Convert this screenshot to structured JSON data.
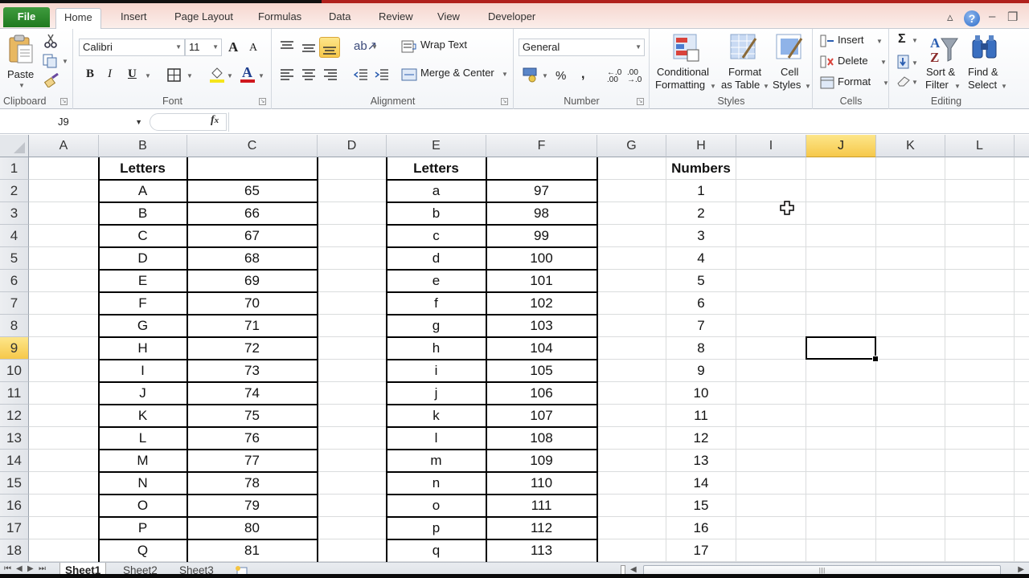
{
  "window": {
    "controls": {
      "minimize_ribbon": "▵",
      "help": "?",
      "minimize": "–",
      "restore": "❐"
    }
  },
  "tabs": [
    {
      "label": "File"
    },
    {
      "label": "Home",
      "active": true
    },
    {
      "label": "Insert"
    },
    {
      "label": "Page Layout"
    },
    {
      "label": "Formulas"
    },
    {
      "label": "Data"
    },
    {
      "label": "Review"
    },
    {
      "label": "View"
    },
    {
      "label": "Developer"
    }
  ],
  "ribbon": {
    "clipboard": {
      "label": "Clipboard",
      "paste": "Paste"
    },
    "font": {
      "label": "Font",
      "name": "Calibri",
      "size": "11",
      "bold": "B",
      "italic": "I",
      "underline": "U",
      "grow": "A",
      "shrink": "A",
      "fill_color": "#f5e51c",
      "font_color": "#d0181e"
    },
    "alignment": {
      "label": "Alignment",
      "wrap_text": "Wrap Text",
      "merge_center": "Merge & Center"
    },
    "number": {
      "label": "Number",
      "format": "General",
      "percent": "%",
      "comma": ",",
      "inc_decimal": "←.0 .00",
      "dec_decimal": ".00 →.0"
    },
    "styles": {
      "label": "Styles",
      "conditional": [
        "Conditional",
        "Formatting"
      ],
      "format_table": [
        "Format",
        "as Table"
      ],
      "cell_styles": [
        "Cell",
        "Styles"
      ]
    },
    "cells": {
      "label": "Cells",
      "insert": "Insert",
      "delete": "Delete",
      "format": "Format"
    },
    "editing": {
      "label": "Editing",
      "sort_filter": [
        "Sort &",
        "Filter"
      ],
      "find_select": [
        "Find &",
        "Select"
      ],
      "sum": "Σ"
    }
  },
  "formula_bar": {
    "name_box": "J9",
    "fx": "fx",
    "value": ""
  },
  "sheet": {
    "columns": [
      "A",
      "B",
      "C",
      "D",
      "E",
      "F",
      "G",
      "H",
      "I",
      "J",
      "K",
      "L"
    ],
    "selected_column": "J",
    "selected_row": 9,
    "selected_cell": "J9",
    "rows": [
      1,
      2,
      3,
      4,
      5,
      6,
      7,
      8,
      9,
      10,
      11,
      12,
      13,
      14,
      15,
      16,
      17,
      18
    ],
    "headers": {
      "B1": "Letters",
      "E1": "Letters",
      "H1": "Numbers"
    },
    "uppercase_letters": [
      "A",
      "B",
      "C",
      "D",
      "E",
      "F",
      "G",
      "H",
      "I",
      "J",
      "K",
      "L",
      "M",
      "N",
      "O",
      "P",
      "Q"
    ],
    "uppercase_codes": [
      "65",
      "66",
      "67",
      "68",
      "69",
      "70",
      "71",
      "72",
      "73",
      "74",
      "75",
      "76",
      "77",
      "78",
      "79",
      "80",
      "81"
    ],
    "lowercase_letters": [
      "a",
      "b",
      "c",
      "d",
      "e",
      "f",
      "g",
      "h",
      "i",
      "j",
      "k",
      "l",
      "m",
      "n",
      "o",
      "p",
      "q"
    ],
    "lowercase_codes": [
      "97",
      "98",
      "99",
      "100",
      "101",
      "102",
      "103",
      "104",
      "105",
      "106",
      "107",
      "108",
      "109",
      "110",
      "111",
      "112",
      "113"
    ],
    "numbers": [
      "1",
      "2",
      "3",
      "4",
      "5",
      "6",
      "7",
      "8",
      "9",
      "10",
      "11",
      "12",
      "13",
      "14",
      "15",
      "16",
      "17"
    ]
  },
  "sheet_tabs": [
    {
      "label": "Sheet1",
      "active": true
    },
    {
      "label": "Sheet2"
    },
    {
      "label": "Sheet3"
    }
  ]
}
